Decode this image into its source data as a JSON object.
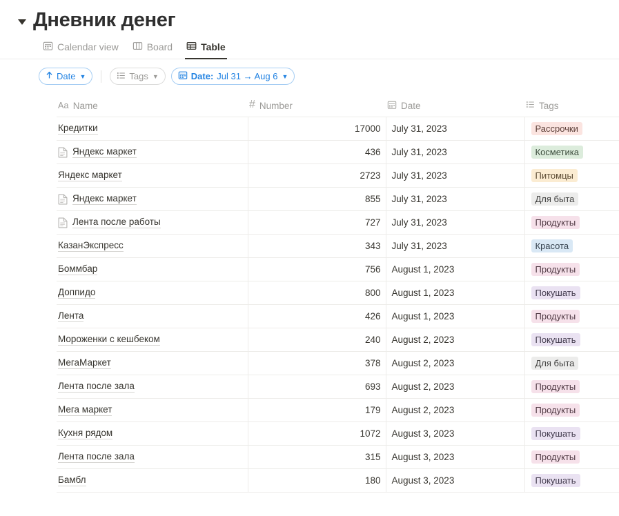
{
  "page": {
    "title": "Дневник денег",
    "collapse_icon": "triangle-down-icon"
  },
  "view_tabs": [
    {
      "label": "Calendar view",
      "icon": "calendar-icon",
      "active": false
    },
    {
      "label": "Board",
      "icon": "board-icon",
      "active": false
    },
    {
      "label": "Table",
      "icon": "table-icon",
      "active": true
    }
  ],
  "filters": {
    "sort": {
      "label": "Date",
      "icon": "arrow-up-icon",
      "chevron": "chevron-down-icon",
      "active": true
    },
    "tags": {
      "label": "Tags",
      "icon": "list-icon",
      "chevron": "chevron-down-icon",
      "active": false
    },
    "date": {
      "prefix": "Date:",
      "label": "Jul 31 → Aug 6",
      "icon": "calendar-icon",
      "chevron": "chevron-down-icon",
      "active": true
    }
  },
  "table": {
    "columns": [
      {
        "label": "Name",
        "icon": "aa-icon"
      },
      {
        "label": "Number",
        "icon": "hash-icon"
      },
      {
        "label": "Date",
        "icon": "calendar-icon"
      },
      {
        "label": "Tags",
        "icon": "list-icon"
      }
    ],
    "rows": [
      {
        "name": "Кредитки",
        "has_page_icon": false,
        "number": "17000",
        "date": "July 31, 2023",
        "tag": "Рассрочки",
        "tag_color": "red"
      },
      {
        "name": "Яндекс маркет",
        "has_page_icon": true,
        "number": "436",
        "date": "July 31, 2023",
        "tag": "Косметика",
        "tag_color": "green"
      },
      {
        "name": "Яндекс маркет",
        "has_page_icon": false,
        "number": "2723",
        "date": "July 31, 2023",
        "tag": "Питомцы",
        "tag_color": "orange"
      },
      {
        "name": "Яндекс маркет",
        "has_page_icon": true,
        "number": "855",
        "date": "July 31, 2023",
        "tag": "Для быта",
        "tag_color": "gray"
      },
      {
        "name": "Лента после работы",
        "has_page_icon": true,
        "number": "727",
        "date": "July 31, 2023",
        "tag": "Продукты",
        "tag_color": "pink"
      },
      {
        "name": "КазанЭкспресс",
        "has_page_icon": false,
        "number": "343",
        "date": "July 31, 2023",
        "tag": "Красота",
        "tag_color": "blue"
      },
      {
        "name": "Боммбар",
        "has_page_icon": false,
        "number": "756",
        "date": "August 1, 2023",
        "tag": "Продукты",
        "tag_color": "pink"
      },
      {
        "name": "Доппидо",
        "has_page_icon": false,
        "number": "800",
        "date": "August 1, 2023",
        "tag": "Покушать",
        "tag_color": "purple"
      },
      {
        "name": "Лента",
        "has_page_icon": false,
        "number": "426",
        "date": "August 1, 2023",
        "tag": "Продукты",
        "tag_color": "pink"
      },
      {
        "name": "Мороженки с кешбеком",
        "has_page_icon": false,
        "number": "240",
        "date": "August 2, 2023",
        "tag": "Покушать",
        "tag_color": "purple"
      },
      {
        "name": "МегаМаркет",
        "has_page_icon": false,
        "number": "378",
        "date": "August 2, 2023",
        "tag": "Для быта",
        "tag_color": "gray"
      },
      {
        "name": "Лента после зала",
        "has_page_icon": false,
        "number": "693",
        "date": "August 2, 2023",
        "tag": "Продукты",
        "tag_color": "pink"
      },
      {
        "name": "Мега маркет",
        "has_page_icon": false,
        "number": "179",
        "date": "August 2, 2023",
        "tag": "Продукты",
        "tag_color": "pink"
      },
      {
        "name": "Кухня рядом",
        "has_page_icon": false,
        "number": "1072",
        "date": "August 3, 2023",
        "tag": "Покушать",
        "tag_color": "purple"
      },
      {
        "name": "Лента после зала",
        "has_page_icon": false,
        "number": "315",
        "date": "August 3, 2023",
        "tag": "Продукты",
        "tag_color": "pink"
      },
      {
        "name": "Бамбл",
        "has_page_icon": false,
        "number": "180",
        "date": "August 3, 2023",
        "tag": "Покушать",
        "tag_color": "purple"
      }
    ]
  },
  "tag_colors": {
    "red": {
      "bg": "#fbe4e0",
      "fg": "#5d4039"
    },
    "green": {
      "bg": "#dcecdc",
      "fg": "#3a4a3b"
    },
    "orange": {
      "bg": "#fbecd2",
      "fg": "#5a4a33"
    },
    "gray": {
      "bg": "#ececeb",
      "fg": "#3f3f3e"
    },
    "pink": {
      "bg": "#f6e1ea",
      "fg": "#4f3943"
    },
    "blue": {
      "bg": "#d9e8f5",
      "fg": "#36424f"
    },
    "purple": {
      "bg": "#eae2f2",
      "fg": "#413a4c"
    }
  },
  "theme": {
    "accent_blue": "#2383e2",
    "text": "#37352f",
    "muted": "#9b9a97",
    "border": "#edece9"
  }
}
